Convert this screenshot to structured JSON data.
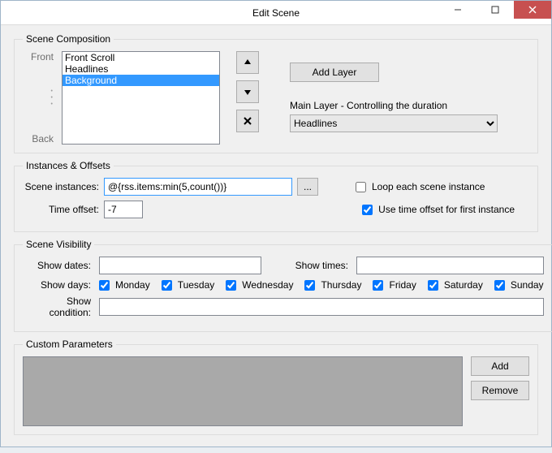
{
  "window": {
    "title": "Edit Scene"
  },
  "composition": {
    "legend": "Scene Composition",
    "front_label": "Front",
    "back_label": "Back",
    "layers": [
      "Front Scroll",
      "Headlines",
      "Background"
    ],
    "selected_index": 2,
    "add_layer_label": "Add Layer",
    "main_layer_caption": "Main Layer - Controlling the duration",
    "main_layer_value": "Headlines"
  },
  "instances": {
    "legend": "Instances & Offsets",
    "scene_instances_label": "Scene instances:",
    "scene_instances_value": "@{rss.items:min(5,count())}",
    "browse_label": "...",
    "time_offset_label": "Time offset:",
    "time_offset_value": "-7",
    "loop_label": "Loop each scene instance",
    "loop_checked": false,
    "use_offset_label": "Use time offset for first instance",
    "use_offset_checked": true
  },
  "visibility": {
    "legend": "Scene Visibility",
    "show_dates_label": "Show dates:",
    "show_dates_value": "",
    "show_times_label": "Show times:",
    "show_times_value": "",
    "show_days_label": "Show days:",
    "days": [
      {
        "label": "Monday",
        "checked": true
      },
      {
        "label": "Tuesday",
        "checked": true
      },
      {
        "label": "Wednesday",
        "checked": true
      },
      {
        "label": "Thursday",
        "checked": true
      },
      {
        "label": "Friday",
        "checked": true
      },
      {
        "label": "Saturday",
        "checked": true
      },
      {
        "label": "Sunday",
        "checked": true
      }
    ],
    "show_condition_label": "Show condition:",
    "show_condition_value": ""
  },
  "custom_params": {
    "legend": "Custom Parameters",
    "add_label": "Add",
    "remove_label": "Remove"
  }
}
